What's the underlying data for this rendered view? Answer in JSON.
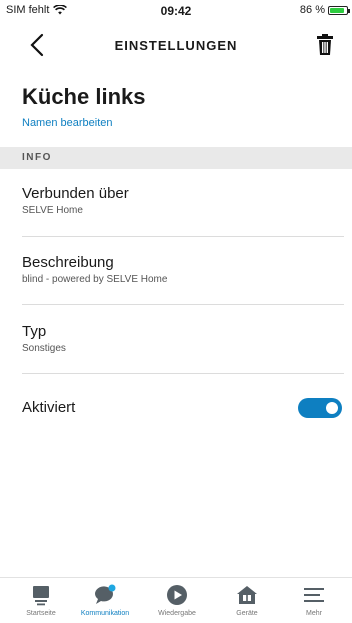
{
  "status_bar": {
    "carrier": "SIM fehlt",
    "time": "09:42",
    "battery": "86 %",
    "battery_level": 0.86,
    "wifi_icon": "wifi-icon",
    "battery_icon": "battery-icon"
  },
  "header": {
    "title": "EINSTELLUNGEN",
    "back_icon": "chevron-left-icon",
    "delete_icon": "trash-icon"
  },
  "device": {
    "name": "Küche links",
    "edit_link": "Namen bearbeiten"
  },
  "section": {
    "label": "INFO"
  },
  "rows": [
    {
      "title": "Verbunden über",
      "value": "SELVE Home"
    },
    {
      "title": "Beschreibung",
      "value": "blind - powered by SELVE Home"
    },
    {
      "title": "Typ",
      "value": "Sonstiges"
    }
  ],
  "activated": {
    "label": "Aktiviert",
    "enabled": true
  },
  "colors": {
    "accent": "#0e7fc1",
    "section_bg": "#e9e9e9",
    "icon_gray": "#555f66"
  },
  "tabs": [
    {
      "label": "Startseite",
      "icon": "home-stack-icon",
      "active": false
    },
    {
      "label": "Kommunikation",
      "icon": "chat-bubble-icon",
      "active": true
    },
    {
      "label": "Wiedergabe",
      "icon": "play-icon",
      "active": false
    },
    {
      "label": "Geräte",
      "icon": "devices-house-icon",
      "active": false
    },
    {
      "label": "Mehr",
      "icon": "menu-icon",
      "active": false
    }
  ]
}
